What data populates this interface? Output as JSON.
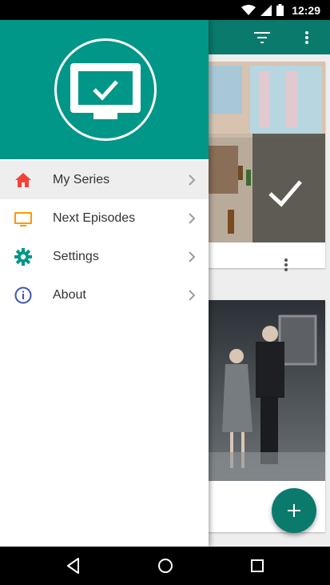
{
  "status_bar": {
    "time": "12:29"
  },
  "drawer": {
    "items": [
      {
        "label": "My Series",
        "icon": "home-icon",
        "icon_color": "#f44336",
        "active": true
      },
      {
        "label": "Next Episodes",
        "icon": "tv-icon",
        "icon_color": "#ff9800",
        "active": false
      },
      {
        "label": "Settings",
        "icon": "gear-icon",
        "icon_color": "#009688",
        "active": false
      },
      {
        "label": "About",
        "icon": "info-icon",
        "icon_color": "#3f51b5",
        "active": false
      }
    ]
  },
  "colors": {
    "primary": "#009688",
    "primary_dark": "#0a7a6c",
    "accent": "#0a7a6c"
  }
}
